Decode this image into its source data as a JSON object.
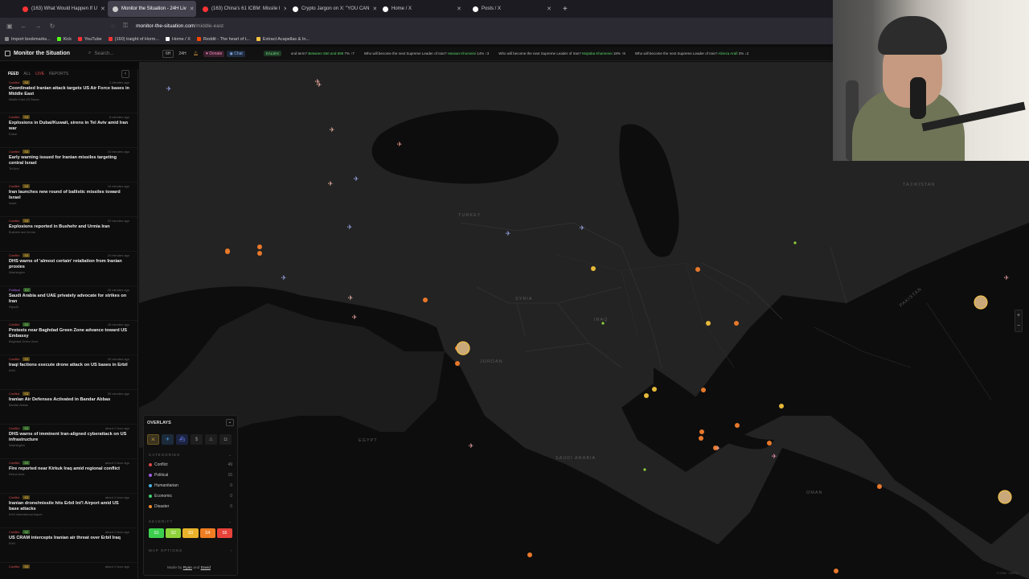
{
  "browser": {
    "tabs": [
      {
        "label": "(163) What Would Happen If U",
        "icon_color": "#ff3333",
        "active": false
      },
      {
        "label": "Monitor the Situation - 24H Liv",
        "icon_color": "#cccccc",
        "active": true
      },
      {
        "label": "(163) China's 61 ICBM: Missile I",
        "icon_color": "#ff3333",
        "active": false
      },
      {
        "label": "Crypto Jargon on X: \"YOU CAN",
        "icon_color": "#ffffff",
        "active": false
      },
      {
        "label": "Home / X",
        "icon_color": "#ffffff",
        "active": false
      },
      {
        "label": "Posts / X",
        "icon_color": "#ffffff",
        "active": false
      }
    ],
    "new_tab": "+",
    "url_domain": "monitor-the-situation.com",
    "url_path": "/middle-east",
    "bookmarks": [
      {
        "label": "Import bookmarks...",
        "color": "#888888"
      },
      {
        "label": "Kick",
        "color": "#53fc18"
      },
      {
        "label": "YouTube",
        "color": "#ff3333"
      },
      {
        "label": "(160) traight of Horm...",
        "color": "#ff3333"
      },
      {
        "label": "Home / X",
        "color": "#ffffff"
      },
      {
        "label": "Reddit - The heart of t...",
        "color": "#ff4500"
      },
      {
        "label": "Extract Acapellas & In...",
        "color": "#f5c542"
      }
    ]
  },
  "app": {
    "title": "Monitor the Situation",
    "search_placeholder": "Search...",
    "range_6h": "6H",
    "range_24h": "24H",
    "donate": "Donate",
    "chat": "Chat",
    "ticker": {
      "source": "KALSHI",
      "items": [
        {
          "text": "ond term?",
          "highlight": "Between 550 and 599",
          "change": "7% ↑7"
        },
        {
          "text": "Who will become the next Supreme Leader of Iran?",
          "highlight": "Hassan Khomeini",
          "change": "14% ↑3"
        },
        {
          "text": "Who will become the next Supreme Leader of Iran?",
          "highlight": "Mojtaba Khamenei",
          "change": "18% ↑8"
        },
        {
          "text": "Who will become the next Supreme Leader of Iran?",
          "highlight": "Alireza Arafi",
          "change": "3% ↓2"
        }
      ]
    }
  },
  "sidebar": {
    "tabs": [
      "FEED",
      "ALL",
      "LIVE",
      "REPORTS"
    ],
    "collapse": "‹",
    "feed": [
      {
        "cat": "Conflict",
        "sev": "S3",
        "time": "2 minutes ago",
        "title": "Coordinated Iranian attack targets US Air Force bases in Middle East",
        "loc": "Middle East US Bases"
      },
      {
        "cat": "Conflict",
        "sev": "S3",
        "time": "8 minutes ago",
        "title": "Explosions in Dubai/Kuwait, sirens in Tel Aviv amid Iran war",
        "loc": "Dubai"
      },
      {
        "cat": "Conflict",
        "sev": "S3",
        "time": "15 minutes ago",
        "title": "Early warning issued for Iranian missiles targeting central Israel",
        "loc": "Tel Aviv"
      },
      {
        "cat": "Conflict",
        "sev": "S3",
        "time": "16 minutes ago",
        "title": "Iran launches new round of ballistic missiles toward Israel",
        "loc": "Israel"
      },
      {
        "cat": "Conflict",
        "sev": "S3",
        "time": "23 minutes ago",
        "title": "Explosions reported in Bushehr and Urmia Iran",
        "loc": "Bushehr and Urmia"
      },
      {
        "cat": "Conflict",
        "sev": "S3",
        "time": "24 minutes ago",
        "title": "DHS warns of 'almost certain' retaliation from Iranian proxies",
        "loc": "Washington"
      },
      {
        "cat": "Political",
        "sev": "S2",
        "time": "26 minutes ago",
        "title": "Saudi Arabia and UAE privately advocate for strikes on Iran",
        "loc": "Riyadh"
      },
      {
        "cat": "Conflict",
        "sev": "S2",
        "time": "28 minutes ago",
        "title": "Protests near Baghdad Green Zone advance toward US Embassy",
        "loc": "Baghdad Green Zone"
      },
      {
        "cat": "Conflict",
        "sev": "S3",
        "time": "30 minutes ago",
        "title": "Iraqi factions execute drone attack on US bases in Erbil",
        "loc": "Erbil"
      },
      {
        "cat": "Conflict",
        "sev": "S3",
        "time": "39 minutes ago",
        "title": "Iranian Air Defenses Activated in Bandar Abbas",
        "loc": "Bandar Abbas"
      },
      {
        "cat": "Conflict",
        "sev": "S2",
        "time": "about 1 hour ago",
        "title": "DHS warns of imminent Iran-aligned cyberattack on US infrastructure",
        "loc": "Washington"
      },
      {
        "cat": "Conflict",
        "sev": "S2",
        "time": "about 1 hour ago",
        "title": "Fire reported near Kirkuk Iraq amid regional conflict",
        "loc": "Kirkuk Area"
      },
      {
        "cat": "Conflict",
        "sev": "S3",
        "time": "about 1 hour ago",
        "title": "Iranian drone/missile hits Erbil Int'l Airport amid US base attacks",
        "loc": "Erbil International Airport"
      },
      {
        "cat": "Conflict",
        "sev": "S2",
        "time": "about 1 hour ago",
        "title": "US CRAM intercepts Iranian air threat over Erbil Iraq",
        "loc": "Erbil"
      },
      {
        "cat": "Conflict",
        "sev": "S3",
        "time": "about 1 hour ago",
        "title": "",
        "loc": ""
      }
    ]
  },
  "overlays": {
    "title": "OVERLAYS",
    "categories_label": "CATEGORIES",
    "categories": [
      {
        "name": "Conflict",
        "count": "49",
        "color": "#e04545"
      },
      {
        "name": "Political",
        "count": "15",
        "color": "#a05ae0"
      },
      {
        "name": "Humanitarian",
        "count": "0",
        "color": "#4ab0e0"
      },
      {
        "name": "Economic",
        "count": "0",
        "color": "#3ecf6e"
      },
      {
        "name": "Disaster",
        "count": "0",
        "color": "#f08c30"
      }
    ],
    "severity_label": "SEVERITY",
    "severity": [
      {
        "label": "S1",
        "color": "#3ccf4e"
      },
      {
        "label": "S2",
        "color": "#8fd13a"
      },
      {
        "label": "S3",
        "color": "#e8b22a"
      },
      {
        "label": "S4",
        "color": "#ef7d22"
      },
      {
        "label": "S5",
        "color": "#e8433a"
      }
    ],
    "map_options": "MAP OPTIONS",
    "made_by_prefix": "Made by",
    "author1": "Ryan",
    "and": "and",
    "author2": "David"
  },
  "map": {
    "labels": [
      {
        "text": "TURKEY"
      },
      {
        "text": "SYRIA"
      },
      {
        "text": "IRAQ"
      },
      {
        "text": "JORDAN"
      },
      {
        "text": "SAUDI ARABIA"
      },
      {
        "text": "EGYPT"
      },
      {
        "text": "PAKISTAN"
      },
      {
        "text": "OMAN"
      },
      {
        "text": "TAJIKISTAN"
      }
    ],
    "zoom_in": "+",
    "zoom_out": "−",
    "attribution": "© OSM · CARTO"
  }
}
